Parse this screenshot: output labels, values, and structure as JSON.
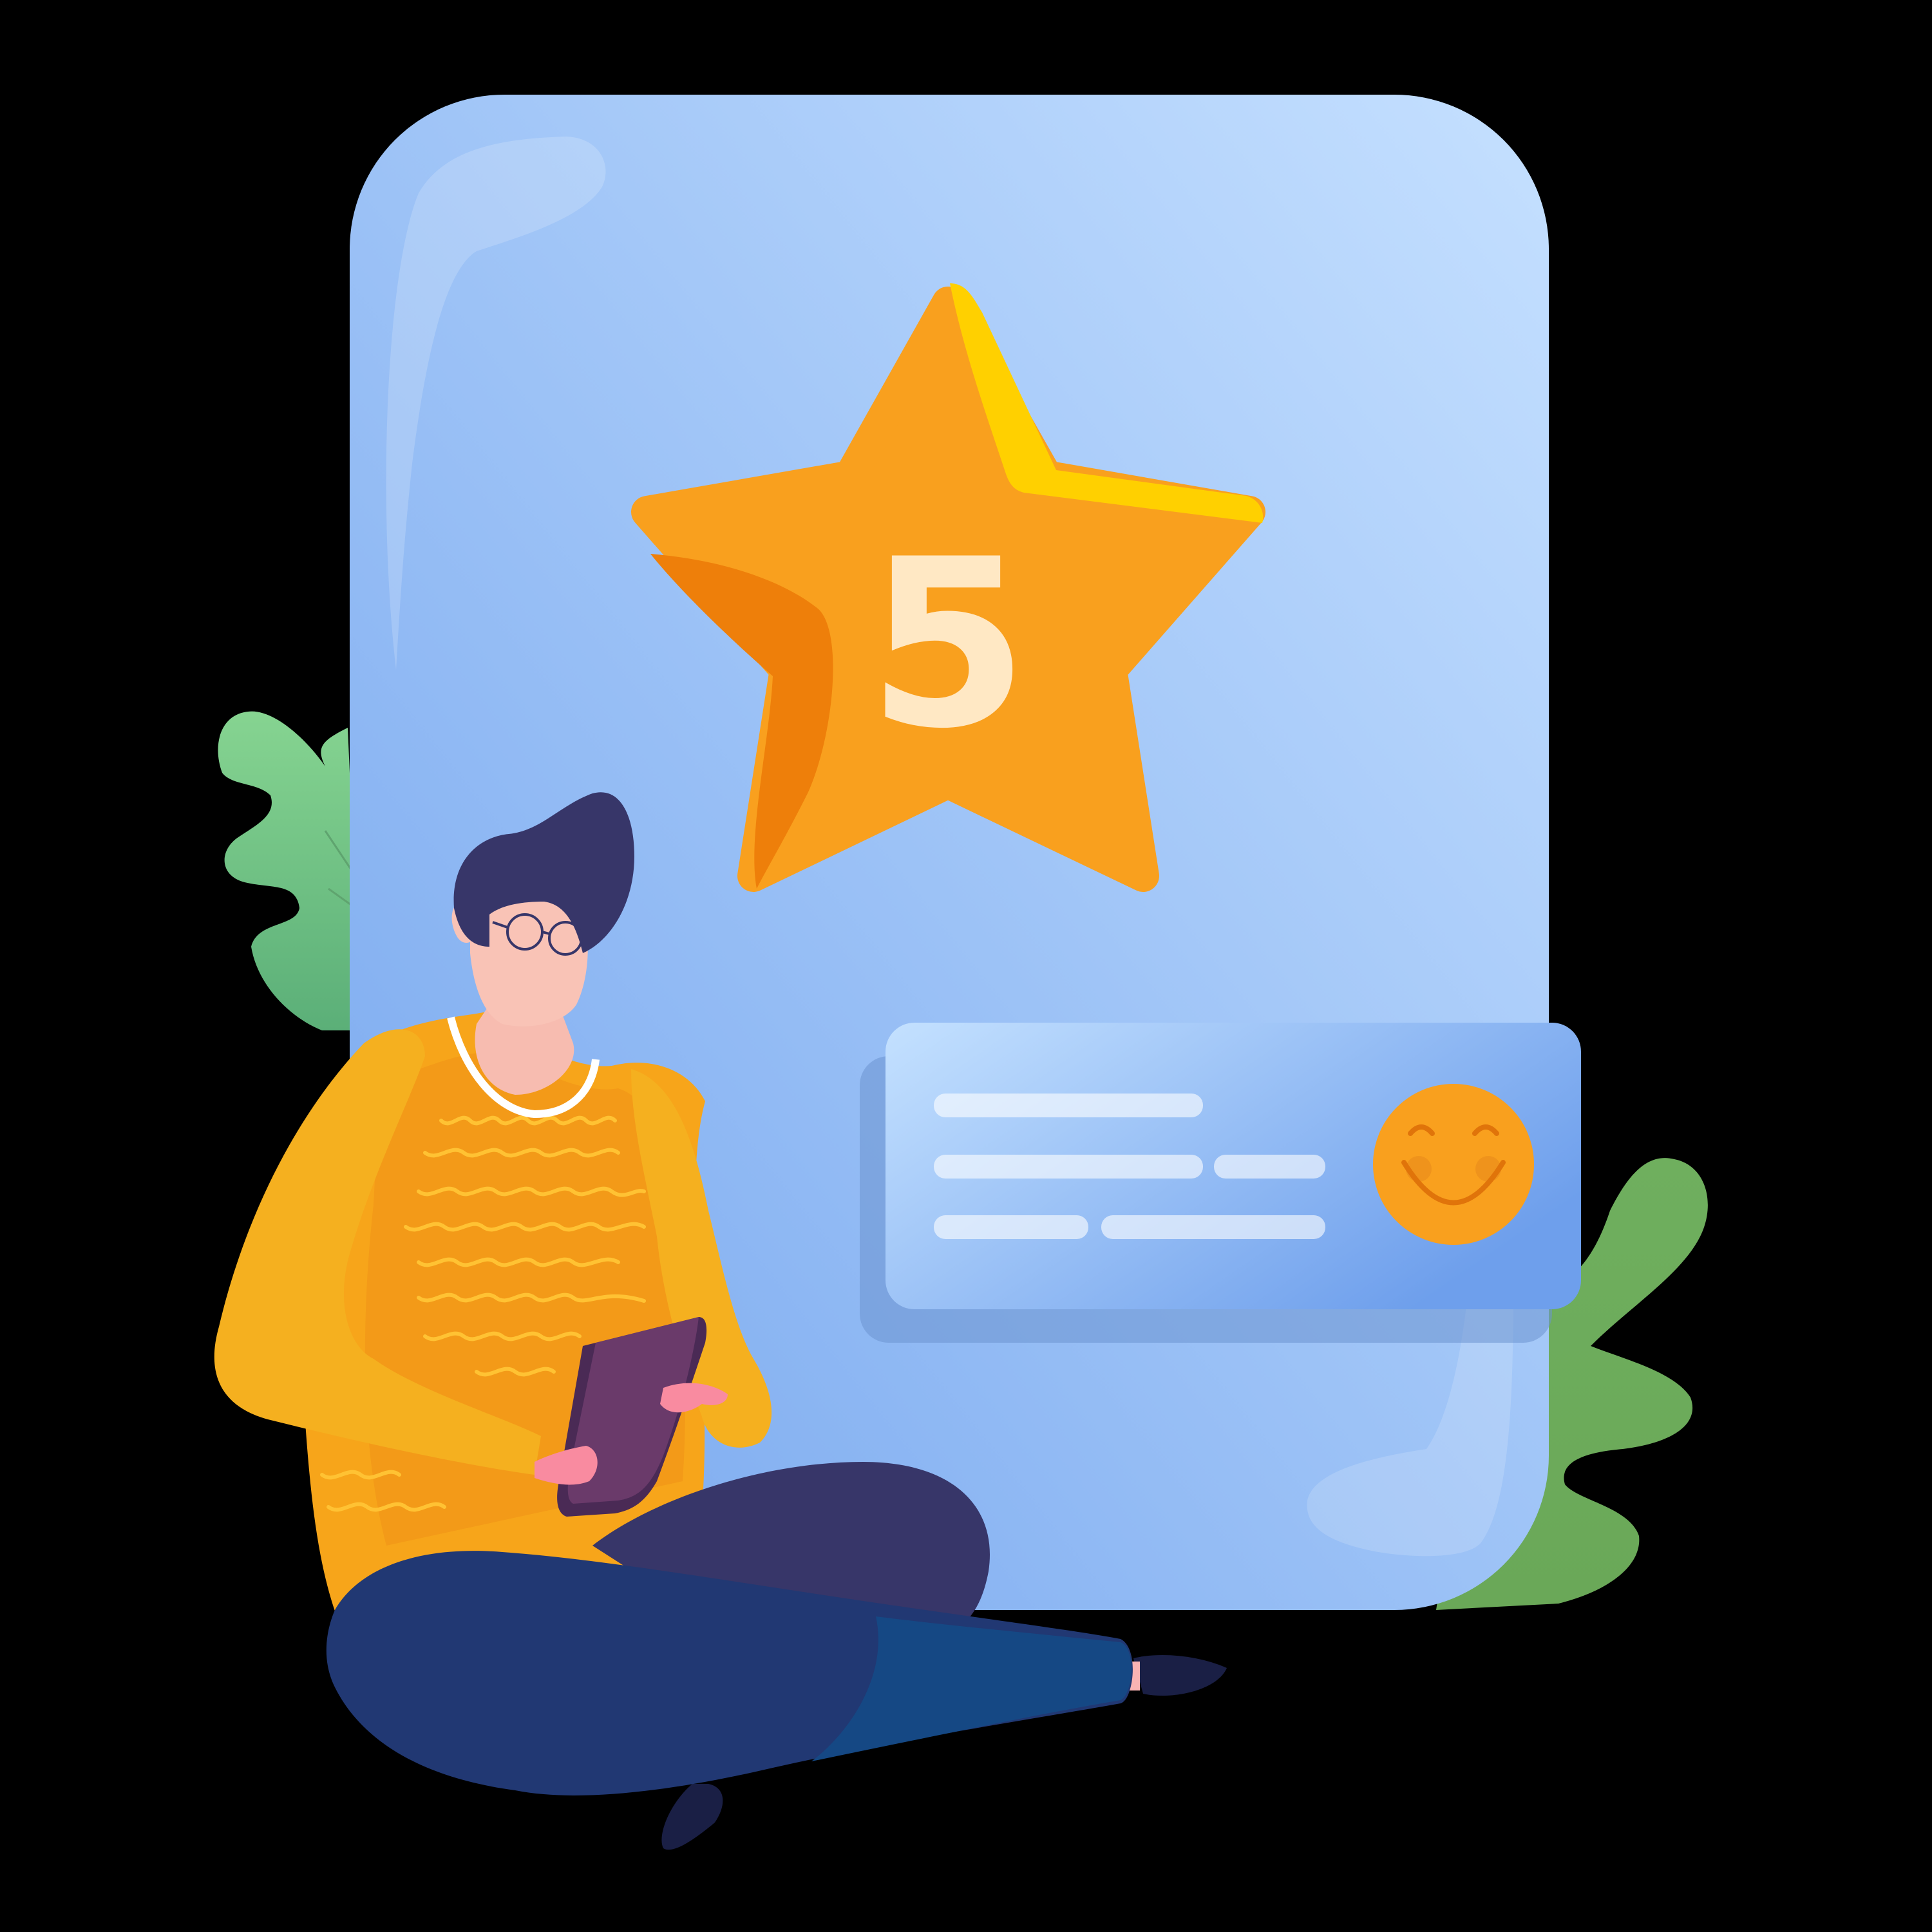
{
  "rating": {
    "value": "5",
    "star_icon": "star-icon",
    "number_color": "#FFE8C4"
  },
  "review_card": {
    "text_lines": 3,
    "emoji_icon": "smiley-face-icon"
  },
  "colors": {
    "background": "#000000",
    "panel_top": "#C2DEFF",
    "panel_bottom": "#79A9EE",
    "star": "#F9A01E",
    "star_shadow": "#EE7F0A",
    "star_highlight": "#FFD000",
    "sweater": "#F7A51A",
    "pants": "#1F3A72",
    "hair": "#373669",
    "tablet": "#6A3A6A",
    "leaf_left": "#7FCB8A",
    "leaf_right": "#6BAA5B",
    "smiley": "#F9A01E"
  }
}
